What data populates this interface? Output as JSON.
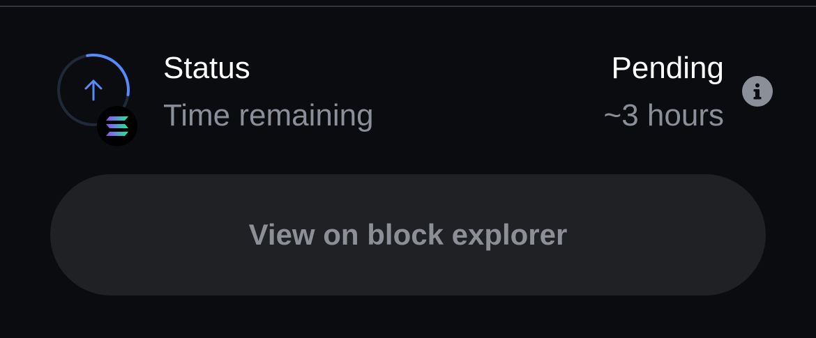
{
  "status": {
    "label": "Status",
    "value": "Pending",
    "progress_fraction": 0.3
  },
  "time_remaining": {
    "label": "Time remaining",
    "value": "~3 hours"
  },
  "icons": {
    "progress": "arrow-up-icon",
    "network": "solana-icon",
    "info": "info-icon"
  },
  "colors": {
    "background": "#0b0c0f",
    "accent_blue": "#578bfa",
    "ring_track": "#1f2937",
    "muted_text": "#8b8f99",
    "button_bg": "#202125",
    "button_text": "#8c8f96"
  },
  "explorer_button": {
    "label": "View on block explorer"
  }
}
